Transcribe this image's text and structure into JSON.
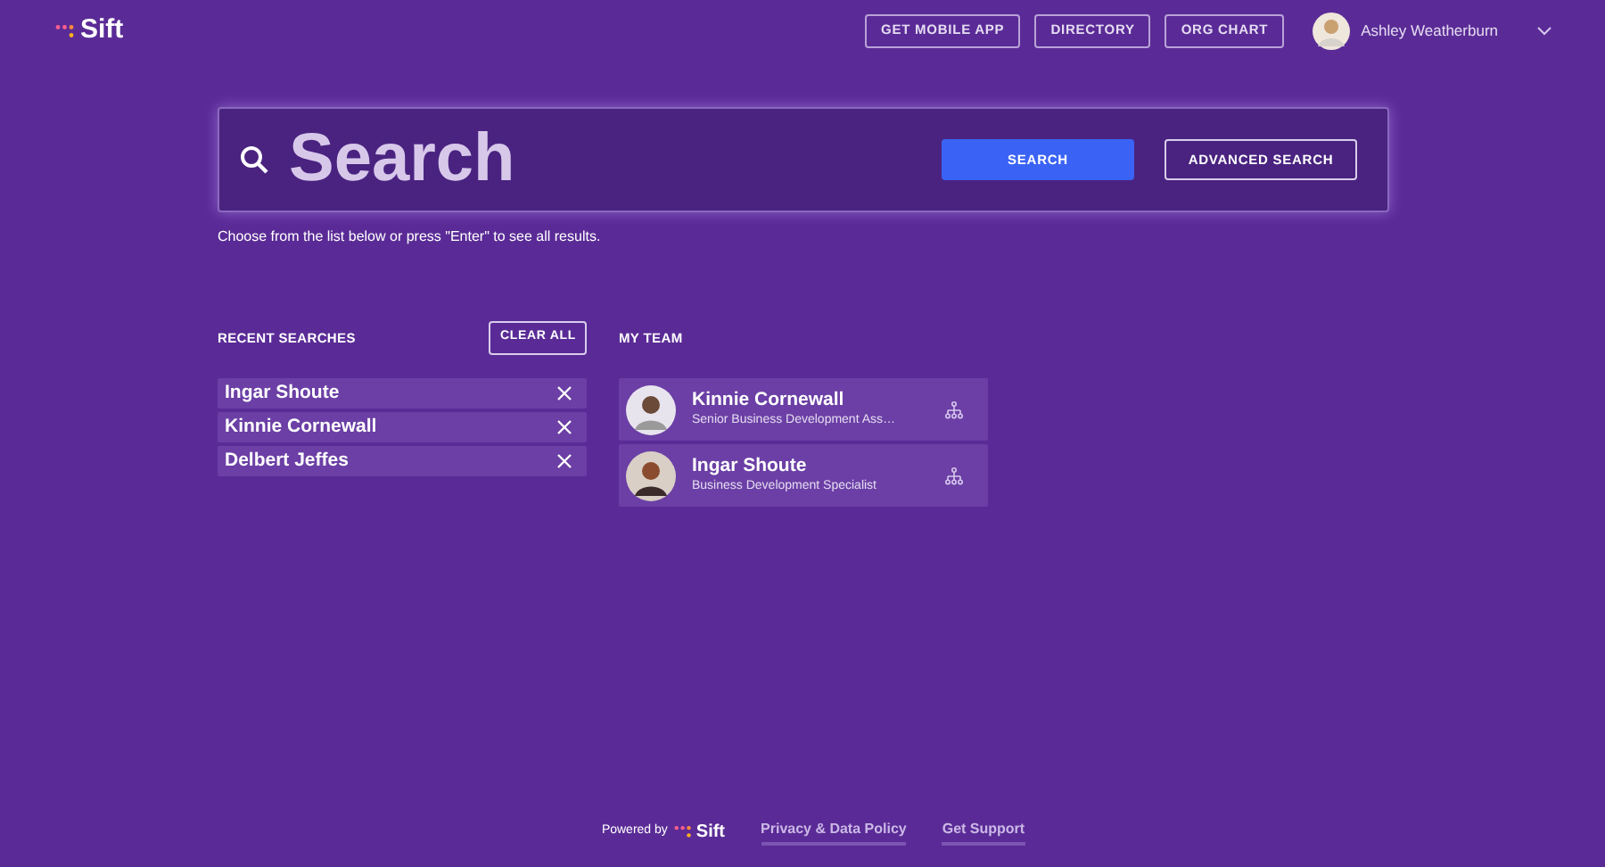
{
  "header": {
    "logo": "Sift",
    "nav": [
      "GET MOBILE APP",
      "DIRECTORY",
      "ORG CHART"
    ],
    "user": {
      "name": "Ashley Weatherburn"
    }
  },
  "search": {
    "placeholder": "Search",
    "buttons": [
      "SEARCH",
      "ADVANCED SEARCH"
    ],
    "hint": "Choose from the list below or press \"Enter\" to see all results."
  },
  "recent_searches": {
    "title": "RECENT SEARCHES",
    "clear": "CLEAR ALL",
    "items": [
      "Ingar Shoute",
      "Kinnie Cornewall",
      "Delbert Jeffes"
    ]
  },
  "my_team": {
    "title": "MY TEAM",
    "members": [
      {
        "name": "Kinnie Cornewall",
        "role": "Senior Business Development Ass…"
      },
      {
        "name": "Ingar Shoute",
        "role": "Business Development Specialist"
      }
    ]
  },
  "footer": {
    "powered_by": "Powered by",
    "logo": "Sift",
    "links": [
      "Privacy & Data Policy",
      "Get Support"
    ]
  }
}
